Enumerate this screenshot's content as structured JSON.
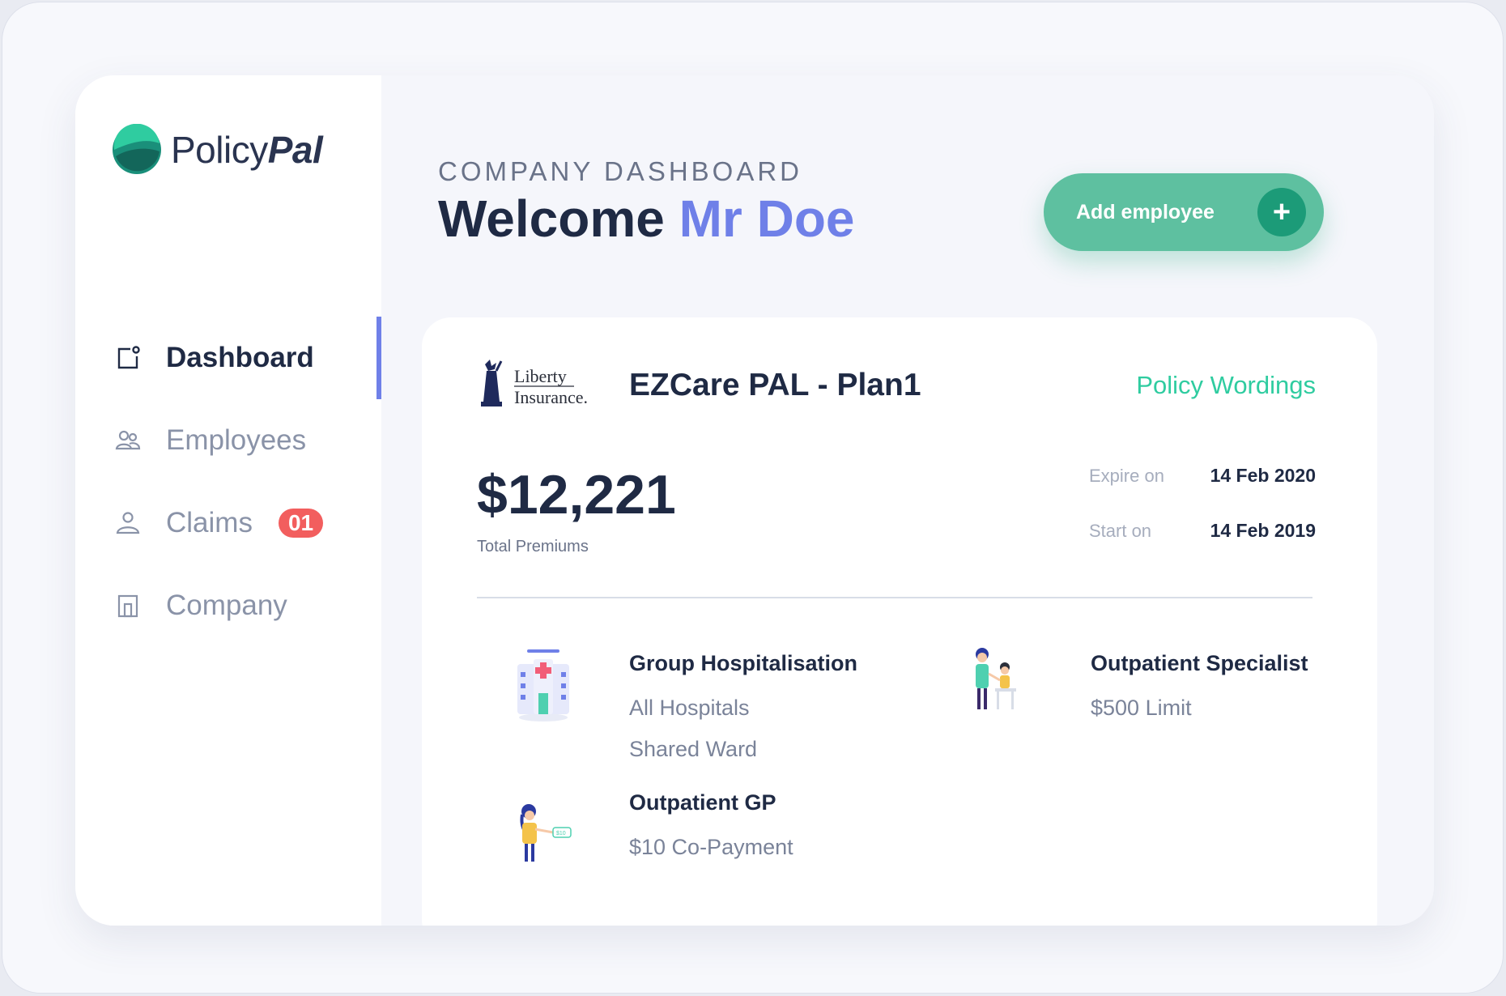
{
  "brand": {
    "logo_text_a": "Policy",
    "logo_text_b": "Pal"
  },
  "sidebar": {
    "items": [
      {
        "label": "Dashboard",
        "icon": "dashboard-icon",
        "active": true
      },
      {
        "label": "Employees",
        "icon": "employees-icon"
      },
      {
        "label": "Claims",
        "icon": "claims-icon",
        "badge": "01"
      },
      {
        "label": "Company",
        "icon": "company-icon"
      }
    ]
  },
  "header": {
    "eyebrow": "COMPANY DASHBOARD",
    "welcome": "Welcome",
    "user_name": "Mr Doe",
    "add_button": "Add employee",
    "add_icon": "+"
  },
  "policy": {
    "insurer_line1": "Liberty",
    "insurer_line2": "Insurance.",
    "plan_name": "EZCare PAL - Plan1",
    "wordings_link": "Policy Wordings",
    "premium": "$12,221",
    "premium_label": "Total Premiums",
    "expire_label": "Expire on",
    "expire_value": "14 Feb 2020",
    "start_label": "Start on",
    "start_value": "14 Feb 2019",
    "benefits": [
      {
        "title": "Group Hospitalisation",
        "lines": [
          "All Hospitals",
          "Shared Ward"
        ],
        "icon": "hospital-icon"
      },
      {
        "title": "Outpatient Specialist",
        "lines": [
          "$500 Limit"
        ],
        "icon": "specialist-icon"
      },
      {
        "title": "Outpatient GP",
        "lines": [
          "$10 Co-Payment"
        ],
        "icon": "gp-icon"
      }
    ]
  },
  "colors": {
    "accent": "#6f80e8",
    "primary_button": "#5ec0a0",
    "link": "#2fcca0",
    "badge": "#f25e5e"
  }
}
